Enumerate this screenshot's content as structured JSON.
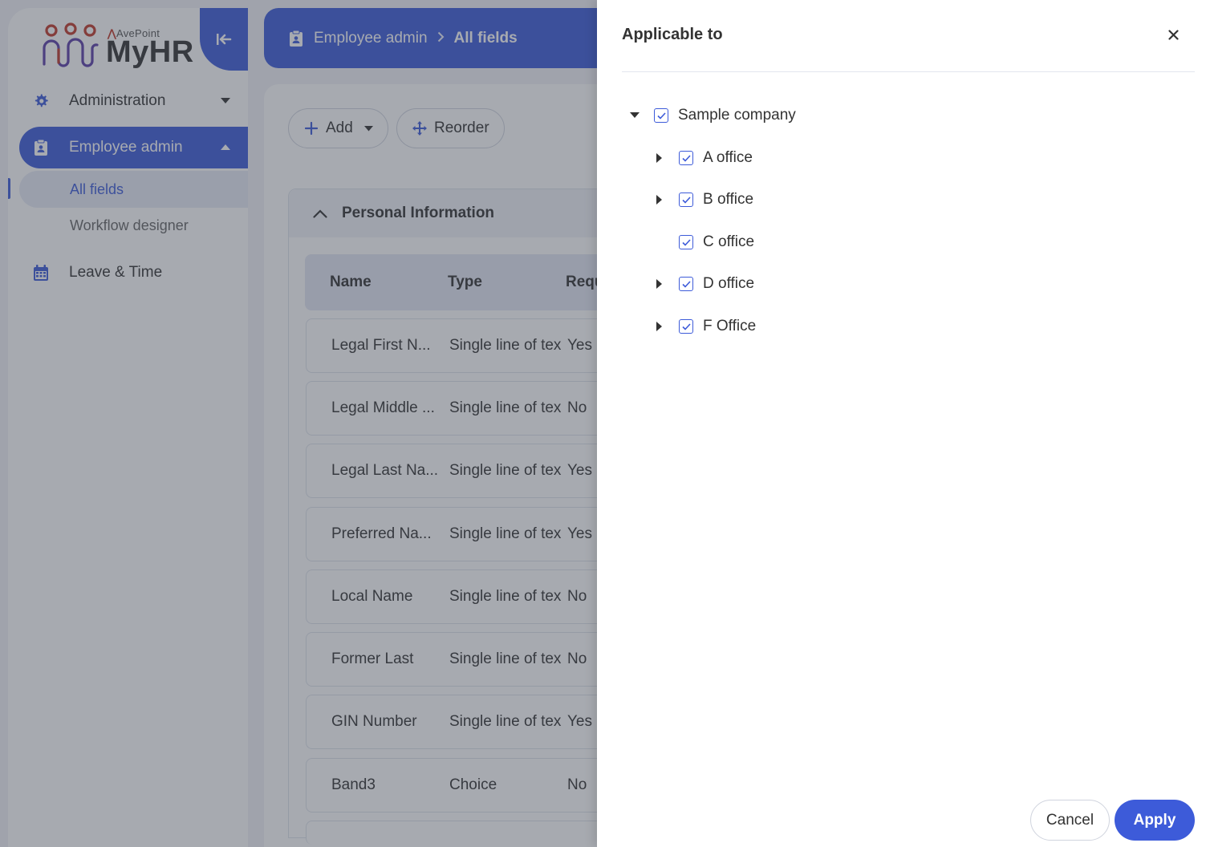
{
  "brand": {
    "vendor": "AvePoint",
    "product": "MyHR",
    "accent_color": "#3d5bd9",
    "logo_color": "#c0392b"
  },
  "sidebar": {
    "collapse_icon": "collapse-left-icon",
    "items": [
      {
        "label": "Administration",
        "icon": "gear-icon",
        "expanded": false
      },
      {
        "label": "Employee admin",
        "icon": "clipboard-icon",
        "expanded": true,
        "active": true
      },
      {
        "label": "Leave & Time",
        "icon": "calendar-icon",
        "expanded": false
      }
    ],
    "sub_items": [
      {
        "label": "All fields",
        "selected": true
      },
      {
        "label": "Workflow designer",
        "selected": false
      }
    ]
  },
  "header": {
    "breadcrumb": [
      "Employee admin",
      "All fields"
    ]
  },
  "toolbar": {
    "add_label": "Add",
    "reorder_label": "Reorder"
  },
  "section": {
    "title": "Personal Information",
    "columns": [
      "Name",
      "Type",
      "Requ"
    ],
    "rows": [
      [
        "Legal First N...",
        "Single line of tex",
        "Yes"
      ],
      [
        "Legal Middle ...",
        "Single line of tex",
        "No"
      ],
      [
        "Legal Last Na...",
        "Single line of tex",
        "Yes"
      ],
      [
        "Preferred Na...",
        "Single line of tex",
        "Yes"
      ],
      [
        "Local Name",
        "Single line of tex",
        "No"
      ],
      [
        "Former Last",
        "Single line of tex",
        "No"
      ],
      [
        "GIN Number",
        "Single line of tex",
        "Yes"
      ],
      [
        "Band3",
        "Choice",
        "No"
      ]
    ]
  },
  "panel": {
    "title": "Applicable to",
    "tree": {
      "label": "Sample company",
      "checked": true,
      "expanded": true,
      "children": [
        {
          "label": "A office",
          "checked": true,
          "has_children": true
        },
        {
          "label": "B office",
          "checked": true,
          "has_children": true
        },
        {
          "label": "C office",
          "checked": true,
          "has_children": false
        },
        {
          "label": "D office",
          "checked": true,
          "has_children": true
        },
        {
          "label": "F Office",
          "checked": true,
          "has_children": true
        }
      ]
    },
    "cancel_label": "Cancel",
    "apply_label": "Apply"
  }
}
